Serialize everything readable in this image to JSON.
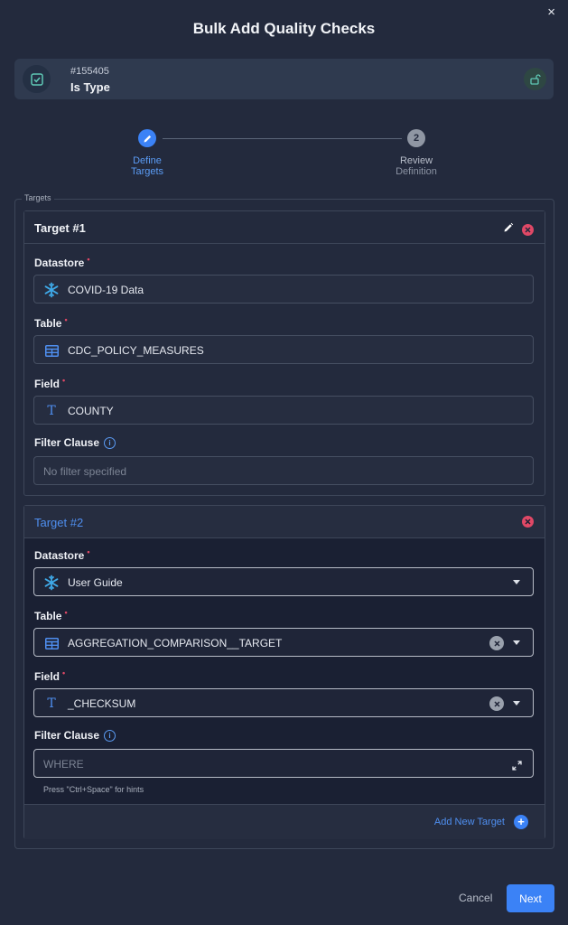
{
  "dialog": {
    "title": "Bulk Add Quality Checks",
    "close_glyph": "×"
  },
  "check": {
    "id": "#155405",
    "name": "Is Type"
  },
  "stepper": {
    "step1": {
      "label_line1": "Define",
      "label_line2": "Targets",
      "state": "active"
    },
    "step2": {
      "number": "2",
      "label_line1": "Review",
      "label_line2": "Definition",
      "state": "pending"
    }
  },
  "targets_legend": "Targets",
  "targets": [
    {
      "title": "Target #1",
      "datastore_label": "Datastore",
      "datastore_value": "COVID-19 Data",
      "table_label": "Table",
      "table_value": "CDC_POLICY_MEASURES",
      "field_label": "Field",
      "field_value": "COUNTY",
      "filter_label": "Filter Clause",
      "filter_placeholder": "No filter specified"
    },
    {
      "title": "Target #2",
      "datastore_label": "Datastore",
      "datastore_value": "User Guide",
      "table_label": "Table",
      "table_value": "AGGREGATION_COMPARISON__TARGET",
      "field_label": "Field",
      "field_value": "_CHECKSUM",
      "filter_label": "Filter Clause",
      "filter_placeholder": "WHERE",
      "hint": "Press \"Ctrl+Space\" for hints"
    }
  ],
  "required_marker": "•",
  "info_glyph": "i",
  "field_type_glyph": "T",
  "add_target_label": "Add New Target",
  "add_glyph": "+",
  "footer": {
    "cancel": "Cancel",
    "next": "Next"
  },
  "colors": {
    "accent": "#3b82f6",
    "danger": "#e04866",
    "background": "#232a3d"
  }
}
